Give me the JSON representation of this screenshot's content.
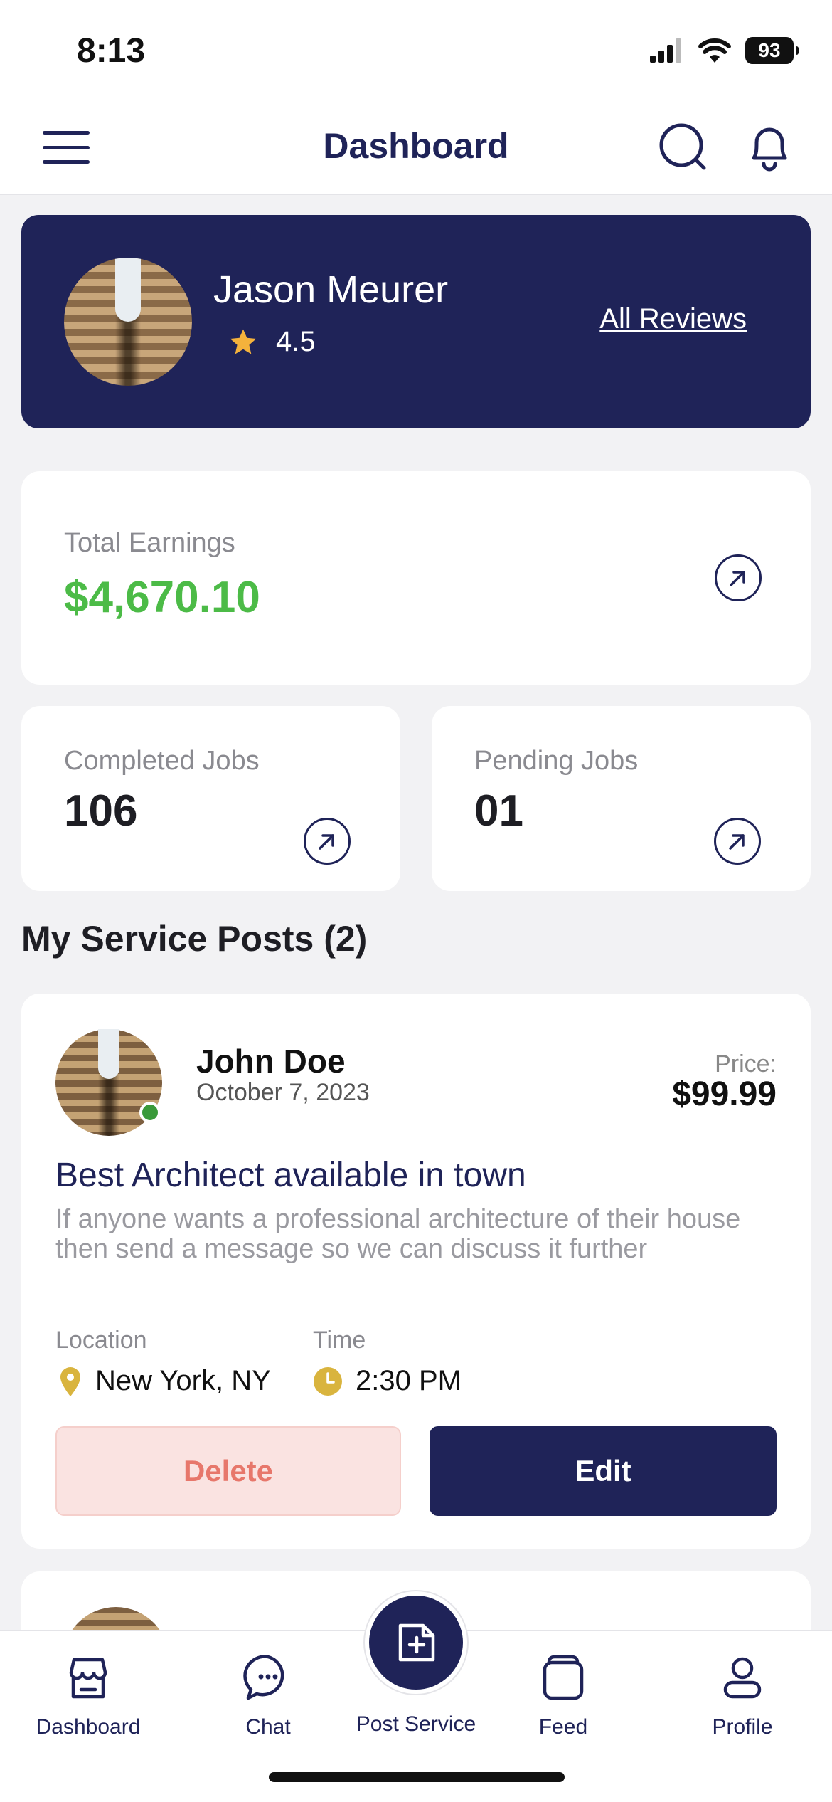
{
  "status_bar": {
    "time": "8:13",
    "battery": "93"
  },
  "header": {
    "title": "Dashboard"
  },
  "profile": {
    "name": "Jason Meurer",
    "rating": "4.5",
    "reviews_link": "All Reviews"
  },
  "stats": {
    "earnings": {
      "label": "Total Earnings",
      "value": "$4,670.10"
    },
    "completed": {
      "label": "Completed Jobs",
      "value": "106"
    },
    "pending": {
      "label": "Pending Jobs",
      "value": "01"
    }
  },
  "section": {
    "title": "My Service Posts (2)"
  },
  "posts": [
    {
      "author": "John Doe",
      "date": "October 7, 2023",
      "price_label": "Price:",
      "price": "$99.99",
      "title": "Best Architect available in town",
      "description": "If anyone wants a professional architecture of their house then send a message so we can discuss it further",
      "location_label": "Location",
      "location": "New York, NY",
      "time_label": "Time",
      "time": "2:30 PM",
      "delete_label": "Delete",
      "edit_label": "Edit"
    }
  ],
  "bottom_nav": {
    "items": [
      {
        "label": "Dashboard",
        "icon": "store-icon"
      },
      {
        "label": "Chat",
        "icon": "chat-icon"
      },
      {
        "label": "Post Service",
        "icon": "add-post-icon"
      },
      {
        "label": "Feed",
        "icon": "feed-icon"
      },
      {
        "label": "Profile",
        "icon": "user-icon"
      }
    ]
  },
  "colors": {
    "primary": "#1f2358",
    "earnings": "#4cbb47",
    "star": "#f4b23c",
    "delete_text": "#e7776b",
    "delete_bg": "#fae3e1",
    "meta_icon": "#d9b43e"
  }
}
